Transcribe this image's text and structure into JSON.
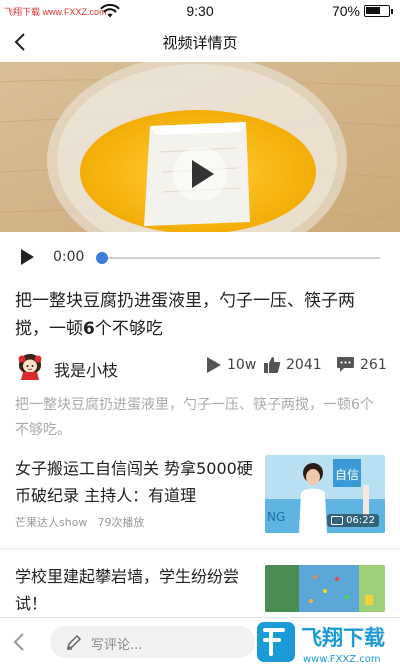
{
  "status_bar": {
    "watermark": "飞翔下载 www.FXXZ.com",
    "time": "9:30",
    "battery_text": "70%",
    "battery_level": 0.7,
    "wifi_icon": "wifi-icon"
  },
  "nav": {
    "title": "视频详情页",
    "back_icon": "back-chevron-icon"
  },
  "player": {
    "current_time": "0:00",
    "progress": 0.0,
    "play_icon": "play-icon",
    "accent_color": "#3b7ddd"
  },
  "video": {
    "title_parts": [
      "把一整块豆腐扔进蛋液里，勺子一压、筷子两搅，一顿",
      "6",
      "个不够吃"
    ],
    "author": {
      "name": "我是小枝",
      "avatar_icon": "cartoon-avatar-icon"
    },
    "stats": {
      "plays": "10w",
      "likes": "2041",
      "comments": "261"
    },
    "description": "把一整块豆腐扔进蛋液里，勺子一压、筷子两搅，一顿6个不够吃。"
  },
  "related": [
    {
      "title": "女子搬运工自信闯关 势拿5000硬币破纪录 主持人：有道理",
      "source": "芒果达人show",
      "play_count": "79次播放",
      "duration": "06:22",
      "thumb_text": "自信"
    },
    {
      "title": "学校里建起攀岩墙，学生纷纷尝试！",
      "source": "",
      "play_count": "",
      "duration": ""
    }
  ],
  "bottom_bar": {
    "comment_placeholder": "写评论...",
    "pencil_icon": "pencil-icon",
    "back_icon": "back-chevron-icon",
    "brand_logo_text": "飞翔下载",
    "brand_logo_url_text": "www.FXXZ.com"
  }
}
